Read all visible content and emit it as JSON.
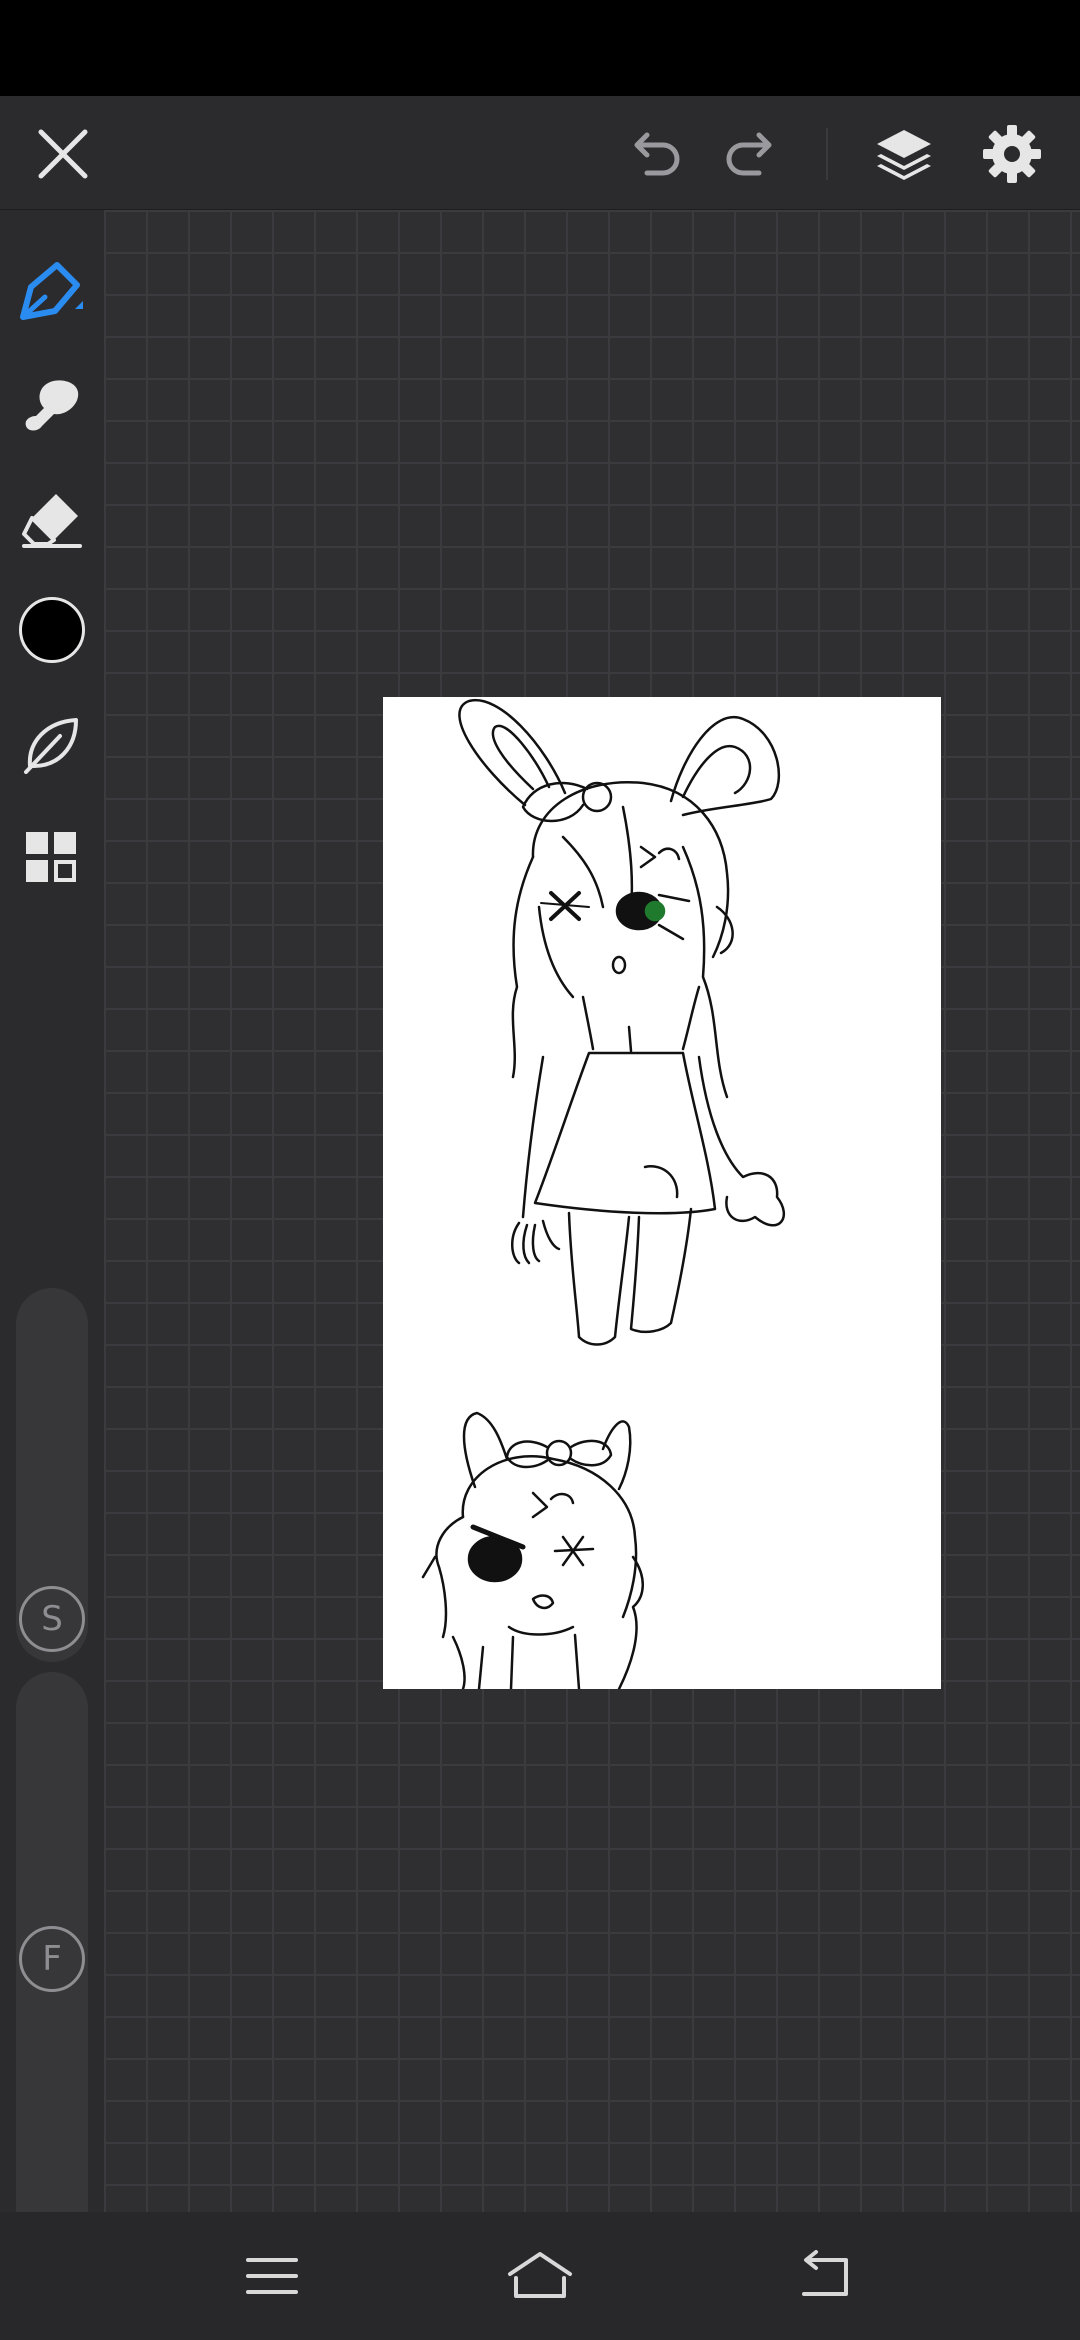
{
  "toolbar": {
    "close_icon": "close-icon",
    "undo_icon": "undo-icon",
    "redo_icon": "redo-icon",
    "layers_icon": "layers-icon",
    "settings_icon": "gear-icon"
  },
  "tools": {
    "active_tool": "pencil",
    "items": [
      "pencil",
      "smudge",
      "eraser",
      "color",
      "stabilizer",
      "grid"
    ],
    "current_color": "#000000",
    "accent_color": "#2a8cf0"
  },
  "sliders": {
    "size_label": "S",
    "flow_label": "F"
  },
  "nav": {
    "menu_icon": "menu-icon",
    "home_icon": "home-icon",
    "back_icon": "back-icon"
  }
}
